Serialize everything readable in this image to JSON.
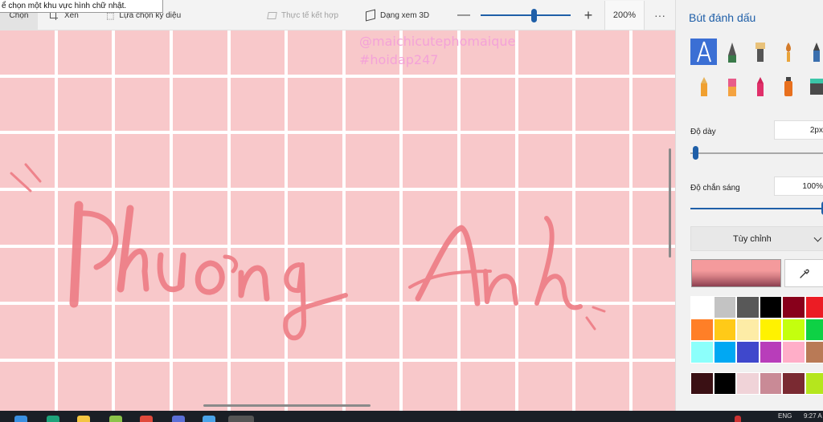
{
  "tooltip": "ể chọn một khu vực hình chữ nhật.",
  "toolbar": {
    "select_label": "Chọn",
    "crop_label": "Xén",
    "magic_select_label": "Lựa chọn kỳ diệu",
    "mixed_reality_label": "Thực tế kết hợp",
    "view_3d_label": "Dạng xem 3D",
    "zoom_out": "—",
    "zoom_in": "+",
    "zoom_value": "200%",
    "more": "···",
    "zoom_slider_level": 0.6
  },
  "canvas": {
    "background_color": "#f8c8ca",
    "grid_color": "#ffffff",
    "lettering_color": "#ee7e86",
    "watermark_line1": "@maichicutephomaique",
    "watermark_line2": "#hoidap247",
    "lettering_word1": "Phương",
    "lettering_word2": "Anh"
  },
  "panel": {
    "title": "Bút đánh dấu",
    "brushes": [
      {
        "name": "calligraphy-pen-icon",
        "active": true
      },
      {
        "name": "fountain-pen-icon",
        "active": false
      },
      {
        "name": "oil-brush-icon",
        "active": false
      },
      {
        "name": "watercolor-icon",
        "active": false
      },
      {
        "name": "pixel-pen-icon",
        "active": false
      },
      {
        "name": "pencil-icon",
        "active": false
      },
      {
        "name": "eraser-icon",
        "active": false
      },
      {
        "name": "crayon-icon",
        "active": false
      },
      {
        "name": "spray-can-icon",
        "active": false
      },
      {
        "name": "fill-icon",
        "active": false
      }
    ],
    "thickness_label": "Độ dày",
    "thickness_value": "2px",
    "thickness_level": 0.02,
    "opacity_label": "Độ chắn sáng",
    "opacity_value": "100%",
    "opacity_level": 1.0,
    "custom_dropdown_label": "Tùy chỉnh",
    "current_color": "#f49a9c",
    "palette": [
      "#ffffff",
      "#c3c3c3",
      "#585858",
      "#000000",
      "#88001b",
      "#ec1c24",
      "#ff7f27",
      "#ffca18",
      "#fdeca6",
      "#fff200",
      "#c4ff0e",
      "#0ed145",
      "#8cfffb",
      "#00a8f3",
      "#3f48cc",
      "#b83dba",
      "#ffaec8",
      "#b97a56"
    ],
    "custom_palette": [
      "#3a1014",
      "#000000",
      "#f0d3d8",
      "#c98a96",
      "#7a2a32",
      "#b5e61d"
    ]
  },
  "taskbar": {
    "lang": "ENG",
    "time": "9:27 A"
  }
}
